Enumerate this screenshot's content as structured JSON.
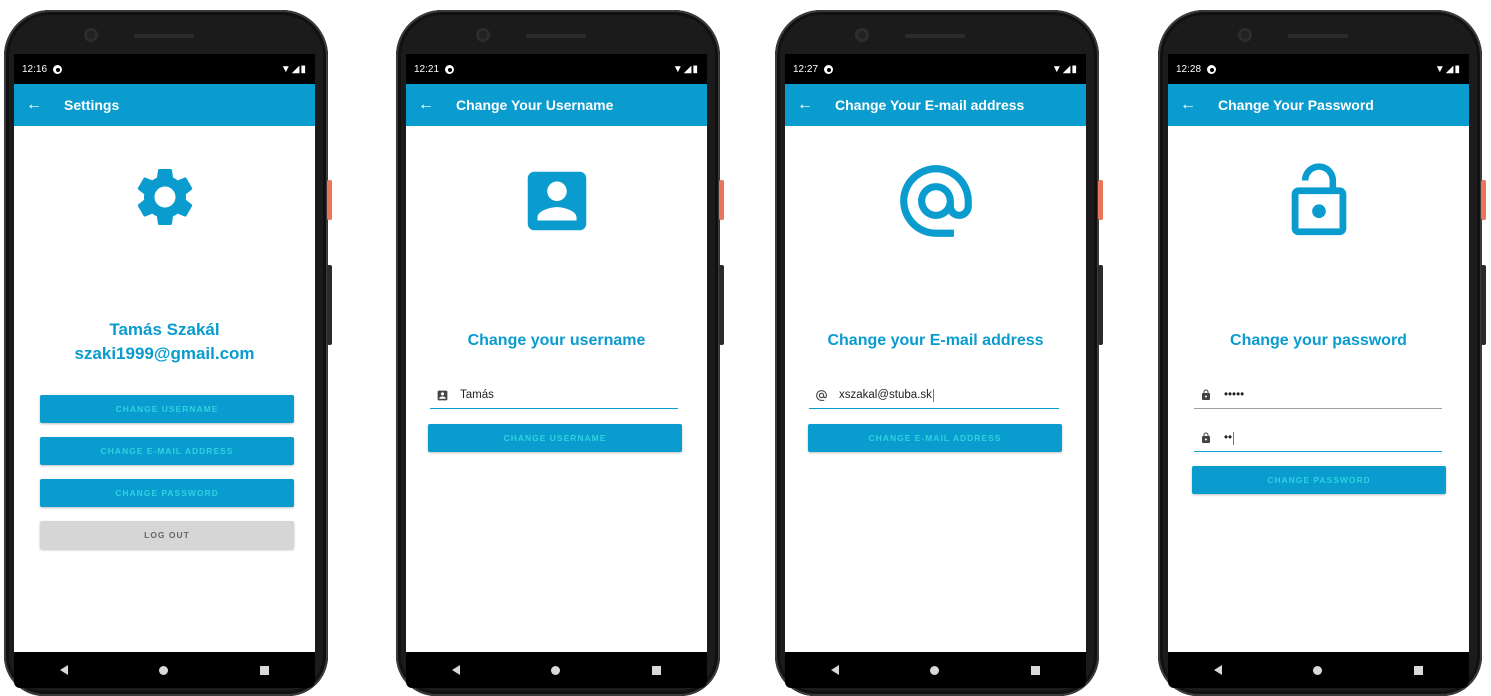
{
  "colors": {
    "accent": "#0a9bcf",
    "button_text": "#2fd2e0",
    "logout_bg": "#d6d6d6"
  },
  "screens": [
    {
      "status_time": "12:16",
      "title": "Settings",
      "hero_icon": "gear-icon",
      "name": "Tamás Szakál",
      "email": "szaki1999@gmail.com",
      "buttons": [
        "CHANGE USERNAME",
        "CHANGE E-MAIL ADDRESS",
        "CHANGE PASSWORD",
        "LOG OUT"
      ]
    },
    {
      "status_time": "12:21",
      "title": "Change Your Username",
      "hero_icon": "account-box-icon",
      "heading": "Change your username",
      "field_icon": "contact-card-icon",
      "field_value": "Tamás",
      "button": "CHANGE USERNAME"
    },
    {
      "status_time": "12:27",
      "title": "Change Your E-mail address",
      "hero_icon": "at-sign-icon",
      "heading": "Change your E-mail address",
      "field_icon": "at-sign-icon",
      "field_value": "xszakal@stuba.sk",
      "button": "CHANGE E-MAIL ADDRESS"
    },
    {
      "status_time": "12:28",
      "title": "Change Your Password",
      "hero_icon": "lock-open-icon",
      "heading": "Change your password",
      "field_icon": "lock-icon",
      "field1_value": "•••••",
      "field2_value": "••",
      "button": "CHANGE PASSWORD"
    }
  ],
  "status_icons": "▼◢▮",
  "nav_icons": [
    "back-triangle-icon",
    "home-circle-icon",
    "recents-square-icon"
  ]
}
